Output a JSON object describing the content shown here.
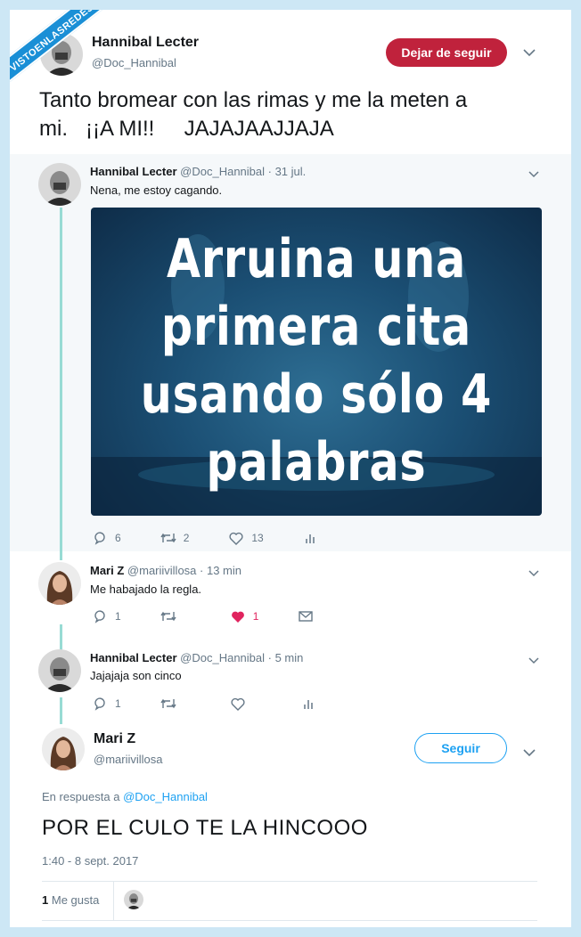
{
  "watermark": "VISTOENLASREDES",
  "main_tweet": {
    "name": "Hannibal Lecter",
    "handle": "@Doc_Hannibal",
    "follow_label": "Dejar de seguir",
    "text_line1": "Tanto bromear con las rimas y me la meten a",
    "text_line2": "mi.   ¡¡A MI!!     JAJAJAAJJAJA"
  },
  "quoted_tweet": {
    "name": "Hannibal Lecter",
    "meta": "@Doc_Hannibal · 31 jul.",
    "text": "Nena, me estoy cagando.",
    "image_lines": [
      "Arruina una",
      "primera cita",
      "usando sólo 4",
      "palabras"
    ],
    "replies": "6",
    "retweets": "2",
    "likes": "13"
  },
  "reply1": {
    "name": "Mari Z",
    "meta": "@mariivillosa · 13 min",
    "text": "Me habajado la regla.",
    "replies": "1",
    "likes": "1"
  },
  "reply2": {
    "name": "Hannibal Lecter",
    "meta": "@Doc_Hannibal · 5 min",
    "text": "Jajajaja son cinco",
    "replies": "1"
  },
  "final_tweet": {
    "name": "Mari Z",
    "handle": "@mariivillosa",
    "follow_label": "Seguir",
    "reply_prefix": "En respuesta a",
    "reply_target": "@Doc_Hannibal",
    "text": "POR EL CULO TE LA HINCOOO",
    "datetime": "1:40 - 8 sept. 2017",
    "likes_count": "1",
    "likes_label": "Me gusta"
  },
  "colors": {
    "follow_red": "#c0223c",
    "twitter_blue": "#1da1f2",
    "like_pink": "#e0245e",
    "thread_line": "#98dbd4"
  }
}
